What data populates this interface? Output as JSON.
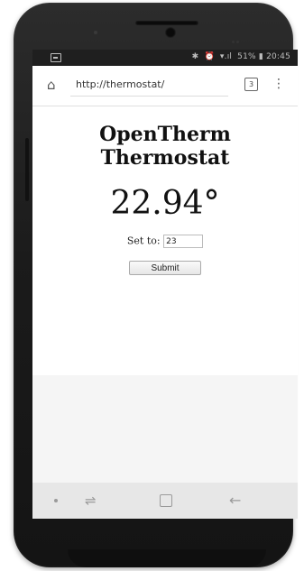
{
  "status_bar": {
    "right_text": "✱ ⏰ ▾.ıl 51% ▮ 20:45",
    "battery": "51%",
    "time": "20:45"
  },
  "browser": {
    "url": "http://thermostat/",
    "tabs_count": "3"
  },
  "page": {
    "title_line1": "OpenTherm",
    "title_line2": "Thermostat",
    "temperature": "22.94°",
    "set_label": "Set to:",
    "set_value": "23",
    "submit_label": "Submit"
  }
}
